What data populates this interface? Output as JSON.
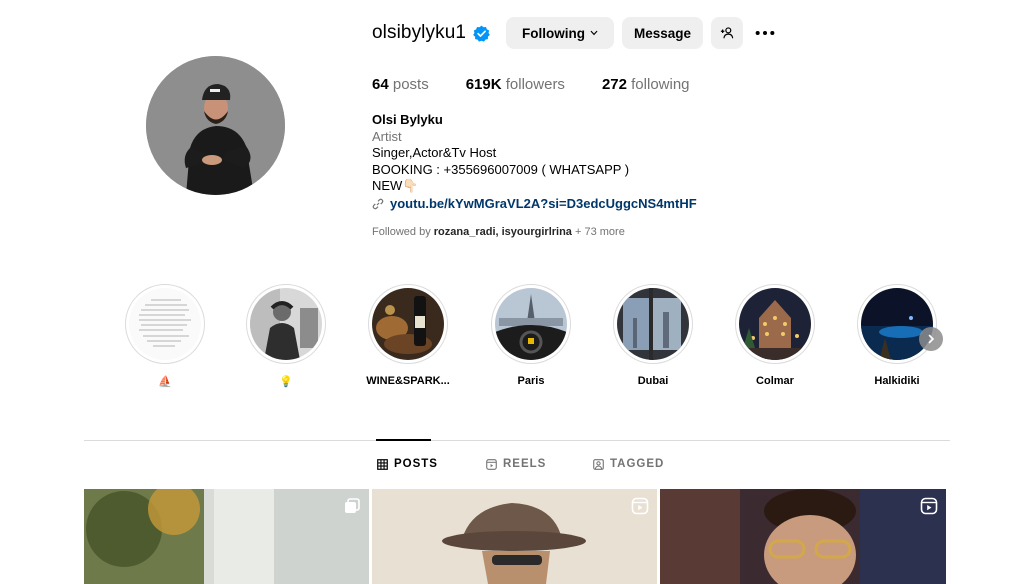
{
  "profile": {
    "username": "olsibylyku1",
    "following_button": "Following",
    "message_button": "Message",
    "stats": {
      "posts_count": "64",
      "posts_label": "posts",
      "followers_count": "619K",
      "followers_label": "followers",
      "following_count": "272",
      "following_label": "following"
    },
    "bio": {
      "name": "Olsi Bylyku",
      "category": "Artist",
      "line1": "Singer,Actor&Tv Host",
      "line2": "BOOKING : +355696007009 ( WHATSAPP )",
      "line3": "NEW👇🏻",
      "link": "youtu.be/kYwMGraVL2A?si=D3edcUggcNS4mtHF"
    },
    "followed_by": {
      "prefix": "Followed by",
      "users": "rozana_radi, isyourgirlrina",
      "suffix": "+ 73 more"
    }
  },
  "highlights": [
    {
      "label": "⛵"
    },
    {
      "label": "💡"
    },
    {
      "label": "WINE&SPARK..."
    },
    {
      "label": "Paris"
    },
    {
      "label": "Dubai"
    },
    {
      "label": "Colmar"
    },
    {
      "label": "Halkidiki"
    }
  ],
  "tabs": {
    "posts": "POSTS",
    "reels": "REELS",
    "tagged": "TAGGED"
  },
  "icons": {
    "verified": "verified-badge-icon",
    "chevron": "chevron-down-icon",
    "add_user": "add-user-icon",
    "more": "more-options-icon",
    "link": "link-icon",
    "grid": "grid-icon",
    "reels": "reels-icon",
    "tagged": "tagged-icon",
    "next": "chevron-right-icon"
  },
  "colors": {
    "verified_blue": "#0095f6",
    "button_bg": "#efefef",
    "secondary_text": "#737373",
    "link": "#00376b",
    "divider": "#dbdbdb"
  }
}
